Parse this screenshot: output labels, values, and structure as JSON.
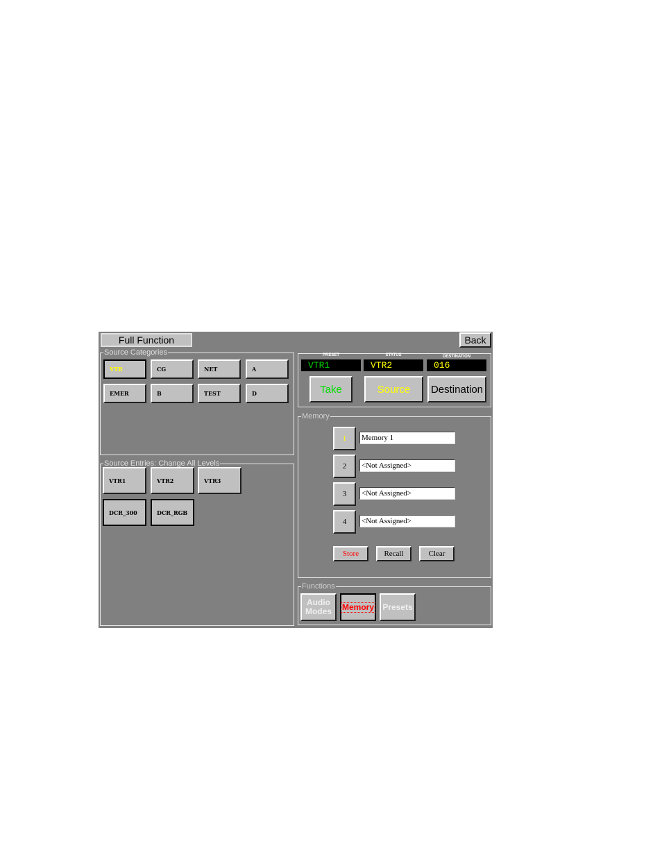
{
  "window": {
    "title": "Full Function",
    "back_label": "Back"
  },
  "source_categories": {
    "label": "Source Categories",
    "items": [
      {
        "label": "VTR",
        "color": "#ffff00",
        "selected": true
      },
      {
        "label": "CG",
        "color": "#000000"
      },
      {
        "label": "NET",
        "color": "#000000"
      },
      {
        "label": "A",
        "color": "#000000"
      },
      {
        "label": "EMER",
        "color": "#000000"
      },
      {
        "label": "B",
        "color": "#000000"
      },
      {
        "label": "TEST",
        "color": "#000000"
      },
      {
        "label": "D",
        "color": "#000000"
      }
    ]
  },
  "source_entries": {
    "label": "Source Entries: Change All Levels",
    "items": [
      {
        "label": "VTR1"
      },
      {
        "label": "VTR2"
      },
      {
        "label": "VTR3"
      },
      {
        "label": "DCR_300"
      },
      {
        "label": "DCR_RGB"
      }
    ]
  },
  "status_panel": {
    "preset": {
      "label": "PRESET",
      "value": "VTR1",
      "color": "#00cc00"
    },
    "status": {
      "label": "STATUS",
      "value": "VTR2",
      "color": "#ffff00"
    },
    "destination": {
      "label": "DESTINATION",
      "value": "016",
      "color": "#ffff00"
    },
    "take_label": "Take",
    "source_label": "Source",
    "destination_label": "Destination",
    "colors": {
      "take": "#00dd00",
      "source": "#ffff00",
      "destination": "#000000"
    }
  },
  "memory": {
    "label": "Memory",
    "slots": [
      {
        "number": "1",
        "name": "Memory 1",
        "active": true
      },
      {
        "number": "2",
        "name": "<Not Assigned>"
      },
      {
        "number": "3",
        "name": "<Not Assigned>"
      },
      {
        "number": "4",
        "name": "<Not Assigned>"
      }
    ],
    "store_label": "Store",
    "recall_label": "Recall",
    "clear_label": "Clear",
    "store_color": "#ff0000"
  },
  "functions": {
    "label": "Functions",
    "audio_modes_label_1": "Audio",
    "audio_modes_label_2": "Modes",
    "memory_label": "Memory",
    "presets_label": "Presets",
    "active_color": "#ff0000"
  }
}
